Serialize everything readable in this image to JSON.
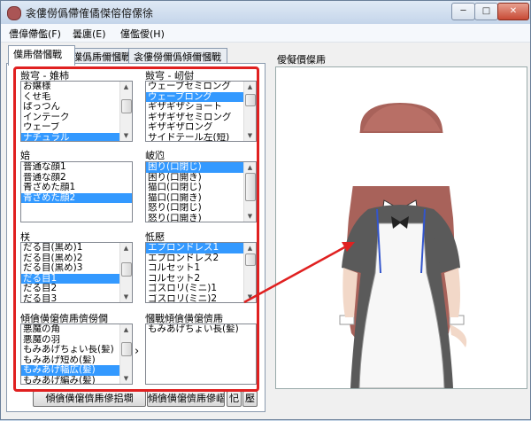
{
  "window": {
    "title": "衾僂僗僞僀傕僪傑傛傛傫徐"
  },
  "titlebar": {
    "minimize_glyph": "─",
    "maximize_glyph": "□",
    "close_glyph": "✕"
  },
  "menu": [
    "僼傽僀儖(F)",
    "曇廤(E)",
    "僿儖僾(H)"
  ],
  "tabs": [
    "僷乕僣慖戰",
    "僷僞乕儞慖戰",
    "衾僂僗儞僞傾儞慖戰"
  ],
  "groups": {
    "hair": {
      "label": "敱宆 - 婎杮",
      "items": [
        "お嬢様",
        "くせ毛",
        "ぱっつん",
        "インテーク",
        "ウェーブ",
        "ナチュラル"
      ]
    },
    "back": {
      "label": "敱宆 - 屻傠",
      "items": [
        "ウェーブセミロング",
        "ウェーブロング",
        "ギザギザショート",
        "ギザギザセミロング",
        "ギザギザロング",
        "サイドテール左(短)"
      ]
    },
    "face": {
      "label": "婄",
      "items": [
        "普通な顔1",
        "普通な顔2",
        "青ざめた顔1",
        "青ざめた顔2"
      ]
    },
    "mouth": {
      "label": "岥尦",
      "items": [
        "困り(口閉じ)",
        "困り(口開き)",
        "猫口(口閉じ)",
        "猫口(口開き)",
        "怒り(口閉じ)",
        "怒り(口開き)"
      ]
    },
    "eyes": {
      "label": "栚",
      "items": [
        "だる目(黒め)1",
        "だる目(黒め)2",
        "だる目(黒め)3",
        "だる目1",
        "だる目2",
        "だる目3"
      ]
    },
    "clothes": {
      "label": "怟懕",
      "items": [
        "エプロンドレス1",
        "エプロンドレス2",
        "コルセット1",
        "コルセット2",
        "ゴスロリ(ミニ)1",
        "ゴスロリ(ミニ)2"
      ]
    },
    "accessory": {
      "label": "傾僋僙僒儕乕儕僗僩",
      "items": [
        "悪魔の角",
        "悪魔の羽",
        "もみあげちょい長(髪)",
        "もみあげ短め(髪)",
        "もみあげ幅広(髪)",
        "もみあげ編み(髪)"
      ]
    },
    "selected": {
      "label": "慖戰傾僋僙僒儕乕",
      "items": [
        "もみあげちょい長(髪)"
      ]
    }
  },
  "transfer_glyph": "›",
  "buttons": {
    "add": "傾僋僙僒儕乕傪捛壛",
    "remove": "傾僋僙僒儕乕傪嶍彍",
    "up": "忋",
    "down": "壓"
  },
  "preview": {
    "label": "僾儗價儏乕"
  },
  "colors": {
    "highlight": "#e02020",
    "selection": "#3399ff"
  }
}
